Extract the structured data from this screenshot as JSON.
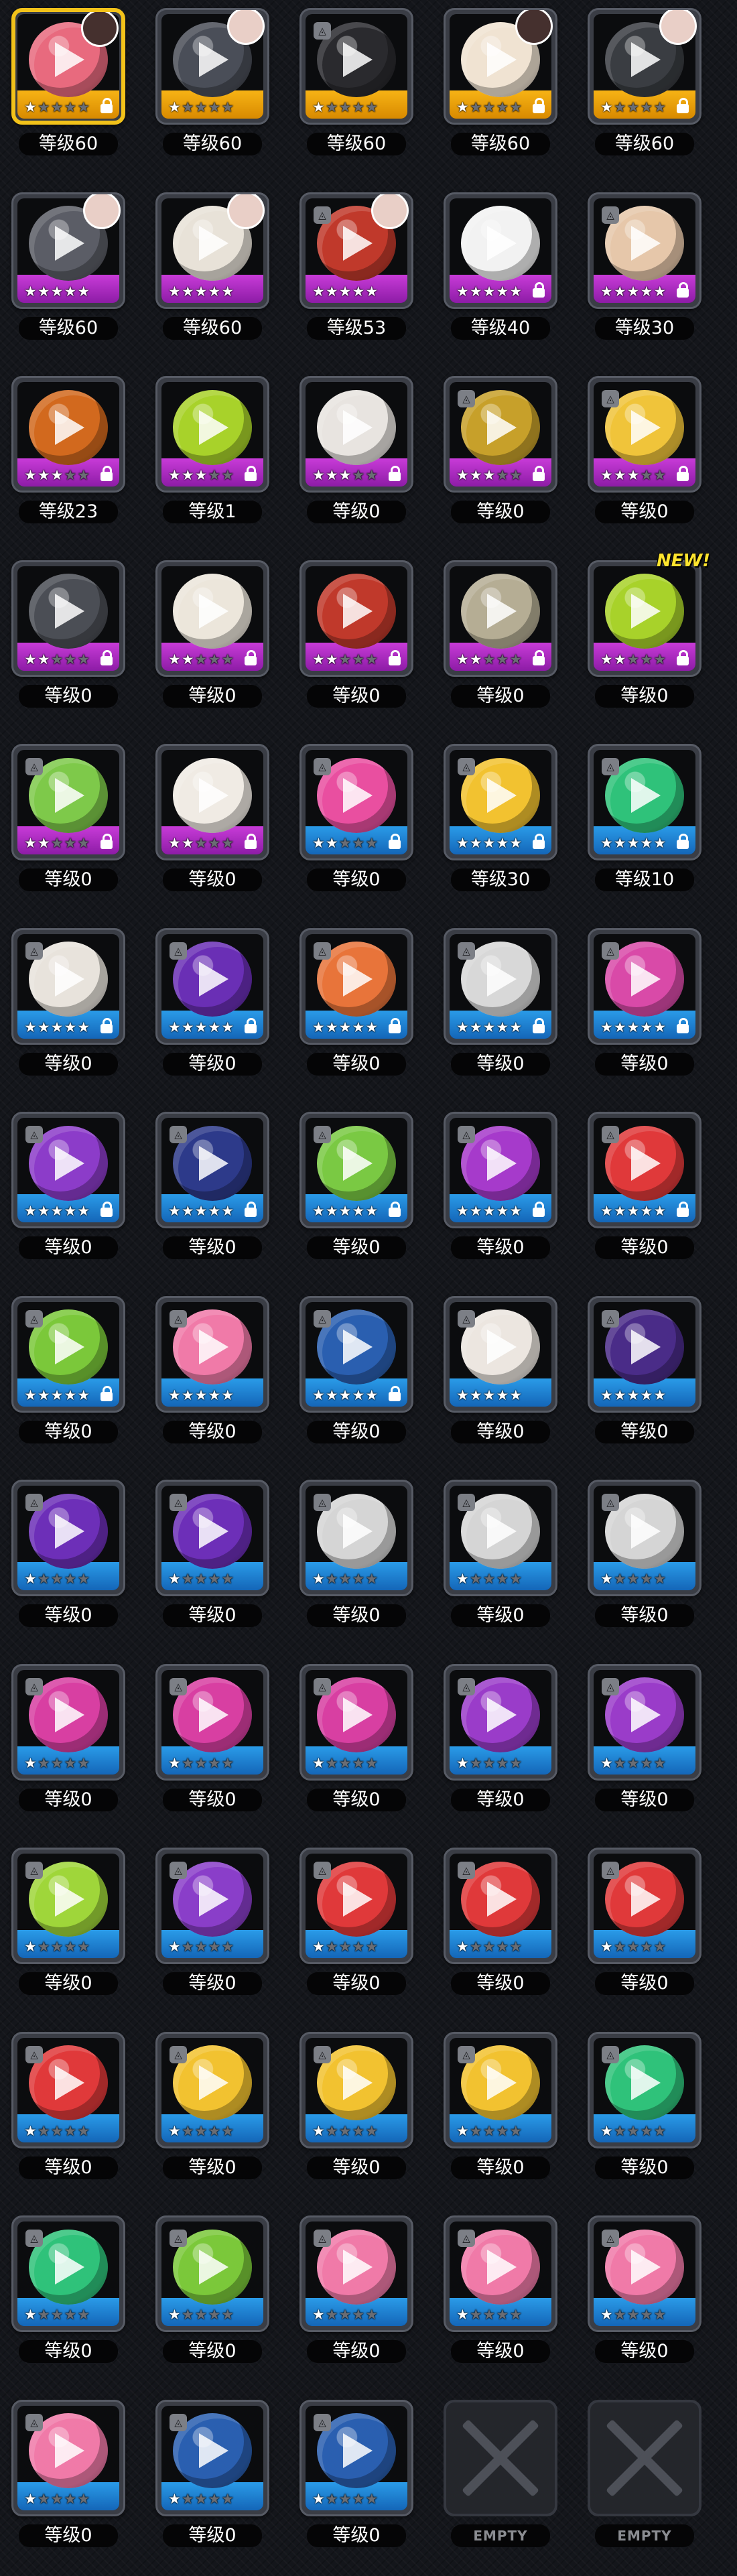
{
  "grid": {
    "items": [
      {
        "level": "等级60",
        "rarity": "gold",
        "color": "#e86a7e",
        "stars": 1,
        "locked": true,
        "icon": "pink-crab-ball-icon",
        "portrait": "dark",
        "selected": true
      },
      {
        "level": "等级60",
        "rarity": "gold",
        "color": "#4a4e58",
        "stars": 1,
        "locked": false,
        "icon": "gray-rock-ball-icon",
        "portrait": "light"
      },
      {
        "level": "等级60",
        "rarity": "gold",
        "color": "#2a2a2e",
        "stars": 1,
        "locked": false,
        "icon": "black-red-ball-icon",
        "corner": true
      },
      {
        "level": "等级60",
        "rarity": "gold",
        "color": "#f0e3d2",
        "stars": 1,
        "locked": true,
        "icon": "cream-ball-icon",
        "portrait": "dark"
      },
      {
        "level": "等级60",
        "rarity": "gold",
        "color": "#3a3d42",
        "stars": 1,
        "locked": true,
        "icon": "black-helmet-ball-icon",
        "portrait": "light"
      },
      {
        "level": "等级60",
        "rarity": "purple",
        "color": "#5b5d66",
        "stars": 5,
        "locked": false,
        "icon": "gold-armor-ball-icon",
        "portrait": "light"
      },
      {
        "level": "等级60",
        "rarity": "purple",
        "color": "#e8e2d8",
        "stars": 5,
        "locked": false,
        "icon": "star-ball-icon",
        "portrait": "light"
      },
      {
        "level": "等级53",
        "rarity": "purple",
        "color": "#c0392b",
        "stars": 5,
        "locked": false,
        "icon": "red-robot-ball-icon",
        "portrait": "light",
        "corner": true
      },
      {
        "level": "等级40",
        "rarity": "purple",
        "color": "#f2f2f2",
        "stars": 5,
        "locked": true,
        "icon": "orange-lens-ball-icon"
      },
      {
        "level": "等级30",
        "rarity": "purple",
        "color": "#e6c7aa",
        "stars": 5,
        "locked": true,
        "icon": "beige-claw-ball-icon",
        "corner": true
      },
      {
        "level": "等级23",
        "rarity": "purple",
        "color": "#d2691e",
        "stars": 3,
        "locked": true,
        "icon": "orange-rock-ball-icon"
      },
      {
        "level": "等级1",
        "rarity": "purple",
        "color": "#a8d22a",
        "stars": 3,
        "locked": true,
        "icon": "green-black-ball-icon"
      },
      {
        "level": "等级0",
        "rarity": "purple",
        "color": "#e8e4e0",
        "stars": 3,
        "locked": true,
        "icon": "red-white-ball-icon"
      },
      {
        "level": "等级0",
        "rarity": "purple",
        "color": "#c7a02a",
        "stars": 3,
        "locked": true,
        "icon": "gold-star-ball-icon",
        "corner": true
      },
      {
        "level": "等级0",
        "rarity": "purple",
        "color": "#f0c43a",
        "stars": 3,
        "locked": true,
        "icon": "yellow-mech-ball-icon",
        "corner": true
      },
      {
        "level": "等级0",
        "rarity": "purple",
        "color": "#4b4e55",
        "stars": 2,
        "locked": true,
        "icon": "lava-ball-icon"
      },
      {
        "level": "等级0",
        "rarity": "purple",
        "color": "#ece6db",
        "stars": 2,
        "locked": true,
        "icon": "skull-ball-icon"
      },
      {
        "level": "等级0",
        "rarity": "purple",
        "color": "#c0392b",
        "stars": 2,
        "locked": true,
        "icon": "hero-mask-ball-icon"
      },
      {
        "level": "等级0",
        "rarity": "purple",
        "color": "#b5ad94",
        "stars": 2,
        "locked": true,
        "icon": "fossil-ball-icon"
      },
      {
        "level": "等级0",
        "rarity": "purple",
        "color": "#a8d22a",
        "stars": 2,
        "locked": true,
        "icon": "green-visor-ball-icon",
        "new": true
      },
      {
        "level": "等级0",
        "rarity": "purple",
        "color": "#7ec94a",
        "stars": 2,
        "locked": true,
        "icon": "monster-mouth-ball-icon",
        "corner": true
      },
      {
        "level": "等级0",
        "rarity": "purple",
        "color": "#f0ebe4",
        "stars": 2,
        "locked": true,
        "icon": "tiger-ball-icon"
      },
      {
        "level": "等级0",
        "rarity": "blue",
        "color": "#e94fa0",
        "stars": 2,
        "locked": true,
        "icon": "block-ball-icon",
        "corner": true
      },
      {
        "level": "等级30",
        "rarity": "blue",
        "color": "#f2c230",
        "stars": 5,
        "locked": true,
        "icon": "yellow-emblem-ball-icon",
        "corner": true
      },
      {
        "level": "等级10",
        "rarity": "blue",
        "color": "#2fc27a",
        "stars": 5,
        "locked": true,
        "icon": "green-emblem-ball-icon",
        "corner": true
      },
      {
        "level": "等级0",
        "rarity": "blue",
        "color": "#e8e3dc",
        "stars": 5,
        "locked": true,
        "icon": "red-core-ball-icon",
        "corner": true
      },
      {
        "level": "等级0",
        "rarity": "blue",
        "color": "#6a2fb5",
        "stars": 5,
        "locked": true,
        "icon": "violet-ball-icon",
        "corner": true
      },
      {
        "level": "等级0",
        "rarity": "blue",
        "color": "#e8743a",
        "stars": 5,
        "locked": true,
        "icon": "orange-core-ball-icon",
        "corner": true
      },
      {
        "level": "等级0",
        "rarity": "blue",
        "color": "#d8d8d8",
        "stars": 5,
        "locked": true,
        "icon": "silver-emblem-ball-icon",
        "corner": true
      },
      {
        "level": "等级0",
        "rarity": "blue",
        "color": "#d94aa8",
        "stars": 5,
        "locked": true,
        "icon": "magenta-emblem-ball-icon",
        "corner": true
      },
      {
        "level": "等级0",
        "rarity": "blue",
        "color": "#8c3cc9",
        "stars": 5,
        "locked": true,
        "icon": "purple-emblem-ball-icon",
        "corner": true
      },
      {
        "level": "等级0",
        "rarity": "blue",
        "color": "#2d3a8a",
        "stars": 5,
        "locked": true,
        "icon": "navy-spike-ball-icon",
        "corner": true
      },
      {
        "level": "等级0",
        "rarity": "blue",
        "color": "#7ac943",
        "stars": 5,
        "locked": true,
        "icon": "lime-spike-ball-icon",
        "corner": true
      },
      {
        "level": "等级0",
        "rarity": "blue",
        "color": "#a63acb",
        "stars": 5,
        "locked": true,
        "icon": "purple-spike-ball-icon",
        "corner": true
      },
      {
        "level": "等级0",
        "rarity": "blue",
        "color": "#e0393a",
        "stars": 5,
        "locked": true,
        "icon": "red-emblem-ball-icon",
        "corner": true
      },
      {
        "level": "等级0",
        "rarity": "blue",
        "color": "#7bc83a",
        "stars": 5,
        "locked": true,
        "icon": "green-triangle-ball-icon",
        "corner": true
      },
      {
        "level": "等级0",
        "rarity": "blue",
        "color": "#f07aa8",
        "stars": 5,
        "locked": false,
        "icon": "pink-lens-ball-icon",
        "corner": true
      },
      {
        "level": "等级0",
        "rarity": "blue",
        "color": "#2a5fb0",
        "stars": 5,
        "locked": true,
        "icon": "blue-lens-ball-icon",
        "corner": true
      },
      {
        "level": "等级0",
        "rarity": "blue",
        "color": "#ece6e0",
        "stars": 5,
        "locked": false,
        "icon": "white-red-lens-ball-icon",
        "corner": true
      },
      {
        "level": "等级0",
        "rarity": "blue",
        "color": "#4a2c88",
        "stars": 5,
        "locked": false,
        "icon": "dark-violet-ball-icon",
        "corner": true
      },
      {
        "level": "等级0",
        "rarity": "blue",
        "color": "#6d2fb8",
        "stars": 1,
        "locked": false,
        "icon": "purple-lens-ball-icon",
        "corner": true
      },
      {
        "level": "等级0",
        "rarity": "blue",
        "color": "#6d2fb8",
        "stars": 1,
        "locked": false,
        "icon": "purple-lens-ball-icon",
        "corner": true
      },
      {
        "level": "等级0",
        "rarity": "blue",
        "color": "#d5d5d5",
        "stars": 1,
        "locked": false,
        "icon": "white-emblem-ball-icon",
        "corner": true
      },
      {
        "level": "等级0",
        "rarity": "blue",
        "color": "#d5d5d5",
        "stars": 1,
        "locked": false,
        "icon": "white-emblem-ball-icon",
        "corner": true
      },
      {
        "level": "等级0",
        "rarity": "blue",
        "color": "#d5d5d5",
        "stars": 1,
        "locked": false,
        "icon": "white-emblem-ball-icon",
        "corner": true
      },
      {
        "level": "等级0",
        "rarity": "blue",
        "color": "#d83fa2",
        "stars": 1,
        "locked": false,
        "icon": "pink-green-emblem-ball-icon",
        "corner": true
      },
      {
        "level": "等级0",
        "rarity": "blue",
        "color": "#d83fa2",
        "stars": 1,
        "locked": false,
        "icon": "pink-green-emblem-ball-icon",
        "corner": true
      },
      {
        "level": "等级0",
        "rarity": "blue",
        "color": "#d83fa2",
        "stars": 1,
        "locked": false,
        "icon": "pink-green-emblem-ball-icon",
        "corner": true
      },
      {
        "level": "等级0",
        "rarity": "blue",
        "color": "#9a3cc9",
        "stars": 1,
        "locked": false,
        "icon": "purple-green-emblem-ball-icon",
        "corner": true
      },
      {
        "level": "等级0",
        "rarity": "blue",
        "color": "#9a3cc9",
        "stars": 1,
        "locked": false,
        "icon": "purple-green-emblem-ball-icon",
        "corner": true
      },
      {
        "level": "等级0",
        "rarity": "blue",
        "color": "#9fd63a",
        "stars": 1,
        "locked": false,
        "icon": "lime-orange-emblem-ball-icon",
        "corner": true
      },
      {
        "level": "等级0",
        "rarity": "blue",
        "color": "#8a3ec9",
        "stars": 1,
        "locked": false,
        "icon": "purple-orange-emblem-ball-icon",
        "corner": true
      },
      {
        "level": "等级0",
        "rarity": "blue",
        "color": "#e0393a",
        "stars": 1,
        "locked": false,
        "icon": "red-grey-emblem-ball-icon",
        "corner": true
      },
      {
        "level": "等级0",
        "rarity": "blue",
        "color": "#e0393a",
        "stars": 1,
        "locked": false,
        "icon": "red-grey-emblem-ball-icon",
        "corner": true
      },
      {
        "level": "等级0",
        "rarity": "blue",
        "color": "#e0393a",
        "stars": 1,
        "locked": false,
        "icon": "red-grey-emblem-ball-icon",
        "corner": true
      },
      {
        "level": "等级0",
        "rarity": "blue",
        "color": "#e0393a",
        "stars": 1,
        "locked": false,
        "icon": "red-grey-emblem-ball-icon",
        "corner": true
      },
      {
        "level": "等级0",
        "rarity": "blue",
        "color": "#f2c230",
        "stars": 1,
        "locked": false,
        "icon": "yellow-blue-emblem-ball-icon",
        "corner": true
      },
      {
        "level": "等级0",
        "rarity": "blue",
        "color": "#f2c230",
        "stars": 1,
        "locked": false,
        "icon": "yellow-blue-emblem-ball-icon",
        "corner": true
      },
      {
        "level": "等级0",
        "rarity": "blue",
        "color": "#f2c230",
        "stars": 1,
        "locked": false,
        "icon": "yellow-blue-emblem-ball-icon",
        "corner": true
      },
      {
        "level": "等级0",
        "rarity": "blue",
        "color": "#2fc27a",
        "stars": 1,
        "locked": false,
        "icon": "green-orange-emblem-ball-icon",
        "corner": true
      },
      {
        "level": "等级0",
        "rarity": "blue",
        "color": "#2fc27a",
        "stars": 1,
        "locked": false,
        "icon": "green-orange-emblem-ball-icon",
        "corner": true
      },
      {
        "level": "等级0",
        "rarity": "blue",
        "color": "#7bc83a",
        "stars": 1,
        "locked": false,
        "icon": "lime-blue-emblem-ball-icon",
        "corner": true
      },
      {
        "level": "等级0",
        "rarity": "blue",
        "color": "#f07aa8",
        "stars": 1,
        "locked": false,
        "icon": "pink-lens-ball-icon",
        "corner": true
      },
      {
        "level": "等级0",
        "rarity": "blue",
        "color": "#f07aa8",
        "stars": 1,
        "locked": false,
        "icon": "pink-lens-ball-icon",
        "corner": true
      },
      {
        "level": "等级0",
        "rarity": "blue",
        "color": "#f07aa8",
        "stars": 1,
        "locked": false,
        "icon": "pink-lens-ball-icon",
        "corner": true
      },
      {
        "level": "等级0",
        "rarity": "blue",
        "color": "#f07aa8",
        "stars": 1,
        "locked": false,
        "icon": "pink-lens-ball-icon",
        "corner": true
      },
      {
        "level": "等级0",
        "rarity": "blue",
        "color": "#2a5fb0",
        "stars": 1,
        "locked": false,
        "icon": "blue-lens-ball-icon",
        "corner": true
      },
      {
        "level": "等级0",
        "rarity": "blue",
        "color": "#2a5fb0",
        "stars": 1,
        "locked": false,
        "icon": "blue-lens-ball-icon",
        "corner": true
      },
      {
        "level": "EMPTY",
        "empty": true
      },
      {
        "level": "EMPTY",
        "empty": true
      }
    ],
    "new_badge_text": "NEW!"
  }
}
